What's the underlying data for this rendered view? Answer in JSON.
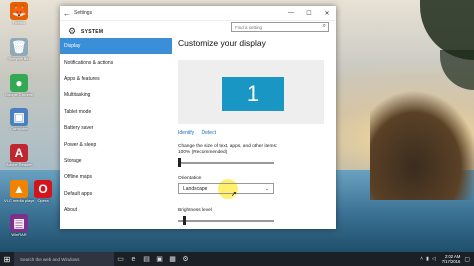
{
  "desktop": {
    "icons": [
      {
        "label": "Firefox",
        "color": "#e66000",
        "glyph": "🦊"
      },
      {
        "label": "Recycle Bin",
        "color": "#8fa9b8",
        "glyph": "🗑"
      },
      {
        "label": "Google Chrome",
        "color": "#34a853",
        "glyph": "●"
      },
      {
        "label": "Computer",
        "color": "#4a7fc1",
        "glyph": "▣"
      },
      {
        "label": "Adobe Reader",
        "color": "#c0262d",
        "glyph": "A"
      },
      {
        "label": "VLC media player",
        "color": "#f08400",
        "glyph": "▲"
      },
      {
        "label": "Opera",
        "color": "#d3141c",
        "glyph": "O"
      },
      {
        "label": "WinRAR",
        "color": "#7e2f8c",
        "glyph": "▤"
      }
    ]
  },
  "window": {
    "title": "Settings",
    "controls": {
      "minimize": "—",
      "maximize": "☐",
      "close": "✕"
    },
    "back_glyph": "←",
    "header": {
      "label": "SYSTEM",
      "search_placeholder": "Find a setting"
    },
    "nav": [
      {
        "label": "Display",
        "active": true
      },
      {
        "label": "Notifications & actions",
        "active": false
      },
      {
        "label": "Apps & features",
        "active": false
      },
      {
        "label": "Multitasking",
        "active": false
      },
      {
        "label": "Tablet mode",
        "active": false
      },
      {
        "label": "Battery saver",
        "active": false
      },
      {
        "label": "Power & sleep",
        "active": false
      },
      {
        "label": "Storage",
        "active": false
      },
      {
        "label": "Offline maps",
        "active": false
      },
      {
        "label": "Default apps",
        "active": false
      },
      {
        "label": "About",
        "active": false
      }
    ],
    "main": {
      "title": "Customize your display",
      "monitor_number": "1",
      "identify_link": "Identify",
      "detect_link": "Detect",
      "scale_text": "Change the size of text, apps, and other items: 100% (Recommended)",
      "scale_value": 0,
      "orientation_label": "Orientation",
      "orientation_value": "Landscape",
      "brightness_label": "Brightness level",
      "brightness_value": 0.05
    }
  },
  "taskbar": {
    "search_placeholder": "Search the web and Windows",
    "time": "2:02 AM",
    "date": "7/17/2016",
    "accent": "#3b8ed8"
  }
}
